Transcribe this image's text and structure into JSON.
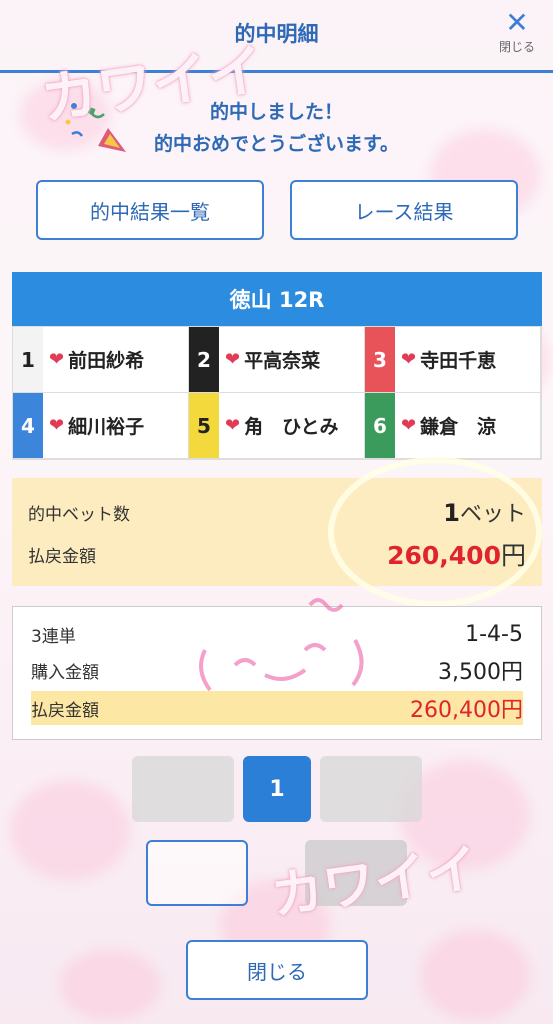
{
  "header": {
    "title": "的中明細",
    "close_label": "閉じる"
  },
  "congrats": {
    "line1": "的中しました！",
    "line2": "的中おめでとうございます。"
  },
  "buttons": {
    "hit_list": "的中結果一覧",
    "race_result": "レース結果"
  },
  "race": {
    "title": "徳山 12R",
    "entries": [
      {
        "num": "1",
        "name": "前田紗希",
        "bg": "#f3f3f3",
        "fg": "#222"
      },
      {
        "num": "2",
        "name": "平高奈菜",
        "bg": "#222222",
        "fg": "#ffffff"
      },
      {
        "num": "3",
        "name": "寺田千恵",
        "bg": "#e8535a",
        "fg": "#ffffff"
      },
      {
        "num": "4",
        "name": "細川裕子",
        "bg": "#3b86db",
        "fg": "#ffffff"
      },
      {
        "num": "5",
        "name": "角　ひとみ",
        "bg": "#f4d93c",
        "fg": "#222"
      },
      {
        "num": "6",
        "name": "鎌倉　涼",
        "bg": "#3a9b5c",
        "fg": "#ffffff"
      }
    ]
  },
  "summary": {
    "bets_label": "的中ベット数",
    "bets_value": "1",
    "bets_unit": "ベット",
    "payout_label": "払戻金額",
    "payout_value": "260,400",
    "payout_unit": "円"
  },
  "detail": {
    "type_label": "3連単",
    "type_value": "1-4-5",
    "purchase_label": "購入金額",
    "purchase_value": "3,500",
    "purchase_unit": "円",
    "payout_label": "払戻金額",
    "payout_value": "260,400",
    "payout_unit": "円"
  },
  "pagination": {
    "current": "1"
  },
  "footer": {
    "close_label": "閉じる"
  },
  "overlay": {
    "text1": "カワイイ",
    "text2": "カワイイ"
  },
  "colors": {
    "accent": "#2e69b6",
    "header_bar": "#2c8ce0",
    "payout_red": "#e0232c"
  }
}
